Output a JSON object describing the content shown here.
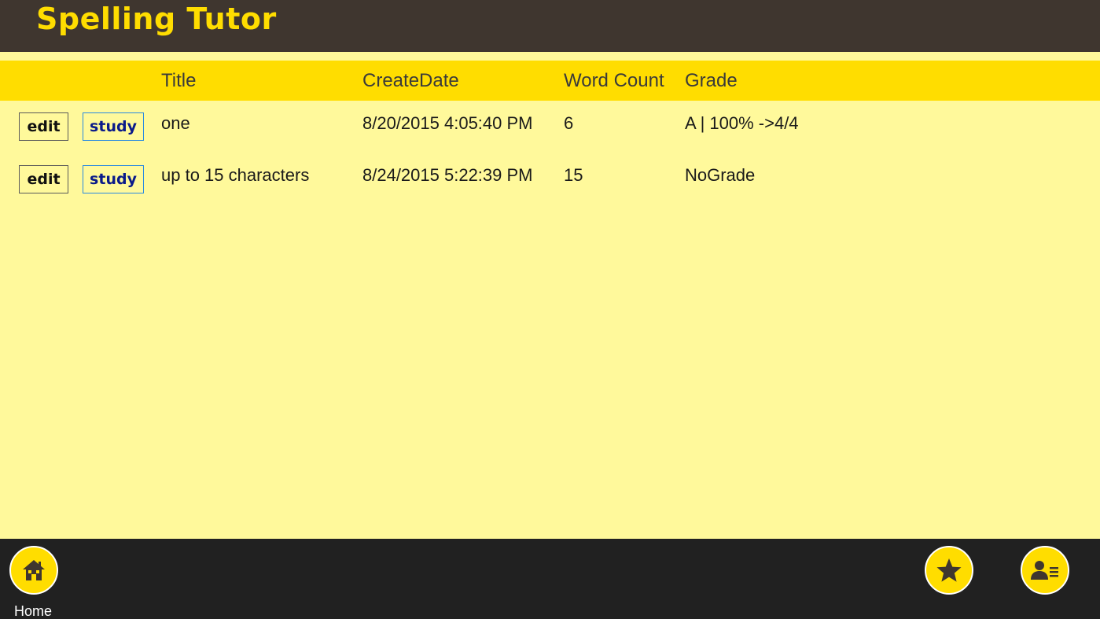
{
  "app": {
    "title": "Spelling Tutor"
  },
  "table": {
    "columns": {
      "title": "Title",
      "create_date": "CreateDate",
      "word_count": "Word Count",
      "grade": "Grade"
    },
    "rows": [
      {
        "edit_label": "edit",
        "study_label": "study",
        "title": "one",
        "create_date": "8/20/2015 4:05:40 PM",
        "word_count": "6",
        "grade": "A | 100% ->4/4"
      },
      {
        "edit_label": "edit",
        "study_label": "study",
        "title": "up to 15 characters",
        "create_date": "8/24/2015 5:22:39 PM",
        "word_count": "15",
        "grade": "NoGrade"
      }
    ]
  },
  "bottom_bar": {
    "home_label": "Home",
    "home_icon": "home-icon",
    "favorite_icon": "star-icon",
    "contacts_icon": "contact-list-icon"
  },
  "colors": {
    "header_bg": "#3f362f",
    "accent_yellow": "#ffdd00",
    "content_bg": "#fff99b",
    "bottom_bar_bg": "#212121"
  }
}
